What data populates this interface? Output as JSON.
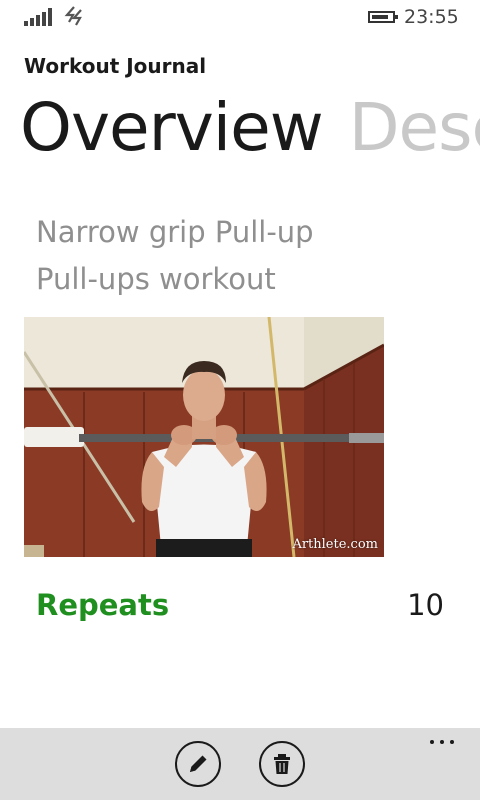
{
  "status_bar": {
    "time": "23:55",
    "signal_icon": "signal-bars-icon",
    "data_icon": "data-connection-icon",
    "battery_icon": "battery-icon",
    "battery_level": 0.85
  },
  "app": {
    "title": "Workout Journal"
  },
  "pivot": {
    "active": "Overview",
    "next": "Desc"
  },
  "exercise": {
    "name": "Narrow grip Pull-up",
    "workout": "Pull-ups workout",
    "image_watermark": "Arthlete.com",
    "repeats_label": "Repeats",
    "repeats_value": "10"
  },
  "app_bar": {
    "edit_icon": "edit-pencil-icon",
    "delete_icon": "trash-icon",
    "more_icon": "more-ellipsis-icon"
  },
  "colors": {
    "accent": "#1f8f1f",
    "app_bar_bg": "#dddddd",
    "inactive_pivot": "#c8c8c8",
    "subtext": "#8f8f8f"
  }
}
